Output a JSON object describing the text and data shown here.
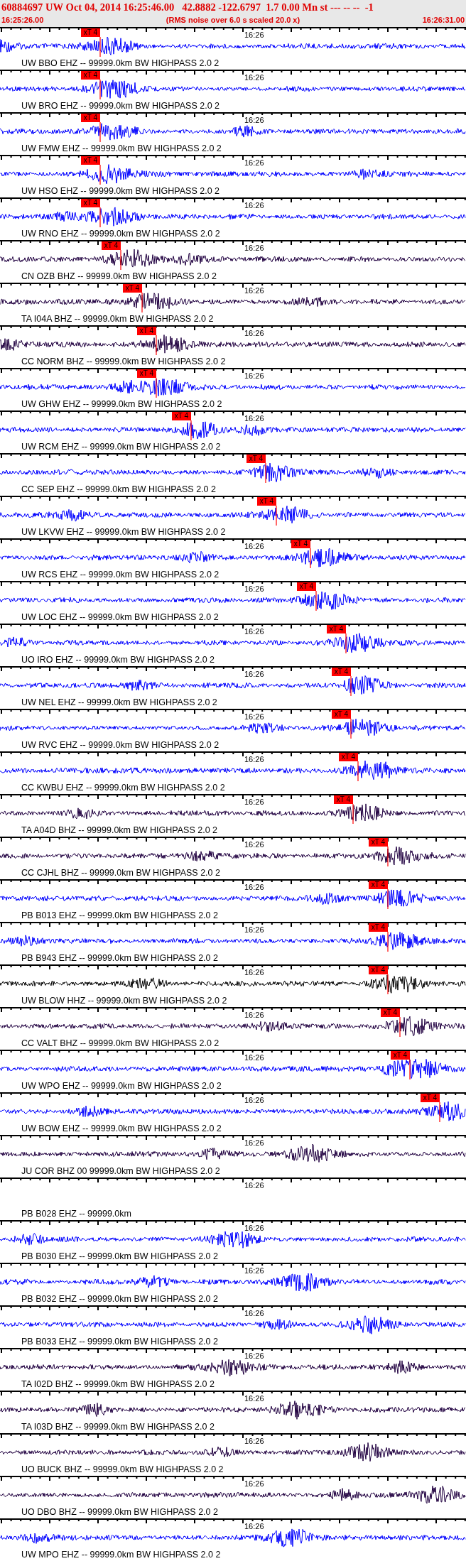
{
  "header": {
    "title": "60884697 UW Oct 04, 2014 16:25:46.00   42.8882 -122.6797  1.7 0.00 Mn st --- -- --  -1",
    "start_time": "16:25:26.00",
    "note": "(RMS noise over 6.0 s scaled 20.0 x)",
    "end_time": "16:26:31.00"
  },
  "traces": [
    {
      "label": "UW BBO EHZ -- 99999.0km BW HIGHPASS 2.0 2",
      "time_mark": "16:26",
      "color": "#0000ff",
      "pick": "xT 4"
    },
    {
      "label": "UW BRO EHZ -- 99999.0km BW HIGHPASS 2.0 2",
      "time_mark": "16:26",
      "color": "#0000ff",
      "pick": "xT 4"
    },
    {
      "label": "UW FMW EHZ -- 99999.0km BW HIGHPASS 2.0 2",
      "time_mark": "16:26",
      "color": "#0000ff",
      "pick": "xT 4"
    },
    {
      "label": "UW HSO EHZ -- 99999.0km BW HIGHPASS 2.0 2",
      "time_mark": "16:26",
      "color": "#0000ff",
      "pick": "xT 4"
    },
    {
      "label": "UW RNO EHZ -- 99999.0km BW HIGHPASS 2.0 2",
      "time_mark": "16:26",
      "color": "#0000ff",
      "pick": "xT 4"
    },
    {
      "label": "CN OZB BHZ -- 99999.0km BW HIGHPASS 2.0 2",
      "time_mark": "16:26",
      "color": "#200040",
      "pick": "xT 4"
    },
    {
      "label": "TA I04A BHZ -- 99999.0km BW HIGHPASS 2.0 2",
      "time_mark": "16:26",
      "color": "#200040",
      "pick": "xT 4"
    },
    {
      "label": "CC NORM BHZ -- 99999.0km BW HIGHPASS 2.0 2",
      "time_mark": "16:26",
      "color": "#200040",
      "pick": "xT 4"
    },
    {
      "label": "UW GHW EHZ -- 99999.0km BW HIGHPASS 2.0 2",
      "time_mark": "16:26",
      "color": "#0000ff",
      "pick": "xT 4"
    },
    {
      "label": "UW RCM EHZ -- 99999.0km BW HIGHPASS 2.0 2",
      "time_mark": "16:26",
      "color": "#0000ff",
      "pick": "xT 4"
    },
    {
      "label": "CC SEP EHZ -- 99999.0km BW HIGHPASS 2.0 2",
      "color": "#0000ff",
      "pick": "xT 4"
    },
    {
      "label": "UW LKVW EHZ -- 99999.0km BW HIGHPASS 2.0 2",
      "color": "#0000ff",
      "pick": "xT 4"
    },
    {
      "label": "UW RCS EHZ -- 99999.0km BW HIGHPASS 2.0 2",
      "time_mark": "16:26",
      "color": "#0000ff",
      "pick": "xT 4"
    },
    {
      "label": "UW LOC EHZ -- 99999.0km BW HIGHPASS 2.0 2",
      "time_mark": "16:26",
      "color": "#0000ff",
      "pick": "xT 4"
    },
    {
      "label": "UO IRO EHZ -- 99999.0km BW HIGHPASS 2.0 2",
      "time_mark": "16:26",
      "color": "#0000ff",
      "pick": "xT 4"
    },
    {
      "label": "UW NEL EHZ -- 99999.0km BW HIGHPASS 2.0 2",
      "time_mark": "16:26",
      "color": "#0000ff",
      "pick": "xT 4"
    },
    {
      "label": "UW RVC EHZ -- 99999.0km BW HIGHPASS 2.0 2",
      "time_mark": "16:26",
      "color": "#0000ff",
      "pick": "xT 4"
    },
    {
      "label": "CC KWBU EHZ -- 99999.0km BW HIGHPASS 2.0 2",
      "time_mark": "16:26",
      "color": "#0000ff",
      "pick": "xT 4"
    },
    {
      "label": "TA A04D BHZ -- 99999.0km BW HIGHPASS 2.0 2",
      "time_mark": "16:26",
      "color": "#200040",
      "pick": "xT 4"
    },
    {
      "label": "CC CJHL BHZ -- 99999.0km BW HIGHPASS 2.0 2",
      "time_mark": "16:26",
      "color": "#200040",
      "pick": "xT 4"
    },
    {
      "label": "PB B013 EHZ -- 99999.0km BW HIGHPASS 2.0 2",
      "time_mark": "16:26",
      "color": "#0000ff",
      "pick": "xT 4"
    },
    {
      "label": "PB B943 EHZ -- 99999.0km BW HIGHPASS 2.0 2",
      "time_mark": "16:26",
      "color": "#0000ff",
      "pick": "xT 4"
    },
    {
      "label": "UW BLOW HHZ -- 99999.0km BW HIGHPASS 2.0 2",
      "time_mark": "16:26",
      "color": "#000000",
      "pick": "xT 4"
    },
    {
      "label": "CC VALT BHZ -- 99999.0km BW HIGHPASS 2.0 2",
      "time_mark": "16:26",
      "color": "#200040",
      "pick": "xT 4"
    },
    {
      "label": "UW WPO EHZ -- 99999.0km BW HIGHPASS 2.0 2",
      "time_mark": "16:26",
      "color": "#0000ff",
      "pick": "xT 4"
    },
    {
      "label": "UW BOW EHZ -- 99999.0km BW HIGHPASS 2.0 2",
      "time_mark": "16:26",
      "color": "#0000ff",
      "pick": "xT 4"
    },
    {
      "label": "JU COR BHZ 00 99999.0km BW HIGHPASS 2.0 2",
      "time_mark": "16:26",
      "color": "#200040"
    },
    {
      "label": "PB B028 EHZ -- 99999.0km",
      "time_mark": "16:26"
    },
    {
      "label": "PB B030 EHZ -- 99999.0km BW HIGHPASS 2.0 2",
      "time_mark": "16:26",
      "color": "#0000ff"
    },
    {
      "label": "PB B032 EHZ -- 99999.0km BW HIGHPASS 2.0 2",
      "time_mark": "16:26",
      "color": "#0000ff"
    },
    {
      "label": "PB B033 EHZ -- 99999.0km BW HIGHPASS 2.0 2",
      "time_mark": "16:26",
      "color": "#0000ff"
    },
    {
      "label": "TA I02D BHZ -- 99999.0km BW HIGHPASS 2.0 2",
      "time_mark": "16:26",
      "color": "#200040"
    },
    {
      "label": "TA I03D BHZ -- 99999.0km BW HIGHPASS 2.0 2",
      "time_mark": "16:26",
      "color": "#200040"
    },
    {
      "label": "UO BUCK BHZ -- 99999.0km BW HIGHPASS 2.0 2",
      "time_mark": "16:26",
      "color": "#200040"
    },
    {
      "label": "UO DBO BHZ -- 99999.0km BW HIGHPASS 2.0 2",
      "time_mark": "16:26",
      "color": "#200040"
    },
    {
      "label": "UW MPO EHZ -- 99999.0km BW HIGHPASS 2.0 2",
      "time_mark": "16:26",
      "color": "#0000ff"
    }
  ]
}
